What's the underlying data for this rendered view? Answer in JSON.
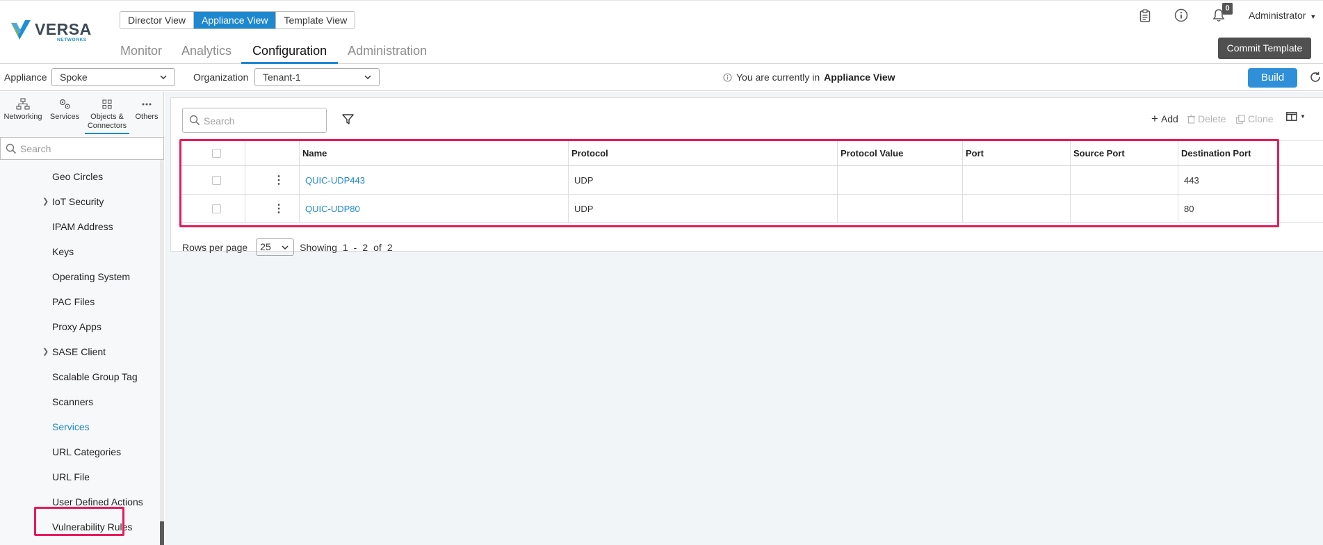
{
  "header": {
    "brand": "VERSA",
    "brand_sub": "NETWORKS",
    "views": [
      "Director View",
      "Appliance View",
      "Template View"
    ],
    "active_view": "Appliance View",
    "tabs": [
      "Monitor",
      "Analytics",
      "Configuration",
      "Administration"
    ],
    "active_tab": "Configuration",
    "notification_count": "0",
    "user": "Administrator",
    "commit_label": "Commit Template"
  },
  "context": {
    "appliance_label": "Appliance",
    "appliance_value": "Spoke",
    "organization_label": "Organization",
    "organization_value": "Tenant-1",
    "info_prefix": "You are currently in",
    "info_view": "Appliance View",
    "build_label": "Build"
  },
  "sidebar": {
    "tabs": [
      {
        "label": "Networking",
        "icon": "network-icon"
      },
      {
        "label": "Services",
        "icon": "services-icon"
      },
      {
        "label": "Objects &",
        "label2": "Connectors",
        "icon": "objects-icon"
      },
      {
        "label": "Others",
        "icon": "more-icon"
      }
    ],
    "active_tab": "Objects & Connectors",
    "search_placeholder": "Search",
    "items": [
      {
        "label": "Geo Circles",
        "expandable": false
      },
      {
        "label": "IoT Security",
        "expandable": true
      },
      {
        "label": "IPAM Address",
        "expandable": false
      },
      {
        "label": "Keys",
        "expandable": false
      },
      {
        "label": "Operating System",
        "expandable": false
      },
      {
        "label": "PAC Files",
        "expandable": false
      },
      {
        "label": "Proxy Apps",
        "expandable": false
      },
      {
        "label": "SASE Client",
        "expandable": true
      },
      {
        "label": "Scalable Group Tag",
        "expandable": false
      },
      {
        "label": "Scanners",
        "expandable": false
      },
      {
        "label": "Services",
        "expandable": false,
        "selected": true
      },
      {
        "label": "URL Categories",
        "expandable": false
      },
      {
        "label": "URL File",
        "expandable": false
      },
      {
        "label": "User Defined Actions",
        "expandable": false
      },
      {
        "label": "Vulnerability Rules",
        "expandable": false
      }
    ]
  },
  "toolbar": {
    "search_placeholder": "Search",
    "add_label": "Add",
    "delete_label": "Delete",
    "clone_label": "Clone"
  },
  "table": {
    "columns": [
      "Name",
      "Protocol",
      "Protocol Value",
      "Port",
      "Source Port",
      "Destination Port"
    ],
    "rows": [
      {
        "name": "QUIC-UDP443",
        "protocol": "UDP",
        "protocol_value": "",
        "port": "",
        "source_port": "",
        "destination_port": "443"
      },
      {
        "name": "QUIC-UDP80",
        "protocol": "UDP",
        "protocol_value": "",
        "port": "",
        "source_port": "",
        "destination_port": "80"
      }
    ]
  },
  "pagination": {
    "rows_per_page_label": "Rows per page",
    "rows_per_page": "25",
    "showing_label": "Showing",
    "from": "1",
    "dash": "-",
    "to": "2",
    "of_label": "of",
    "total": "2"
  },
  "colors": {
    "accent": "#1e88cf",
    "highlight": "#e8195c",
    "commit_bg": "#505050"
  }
}
